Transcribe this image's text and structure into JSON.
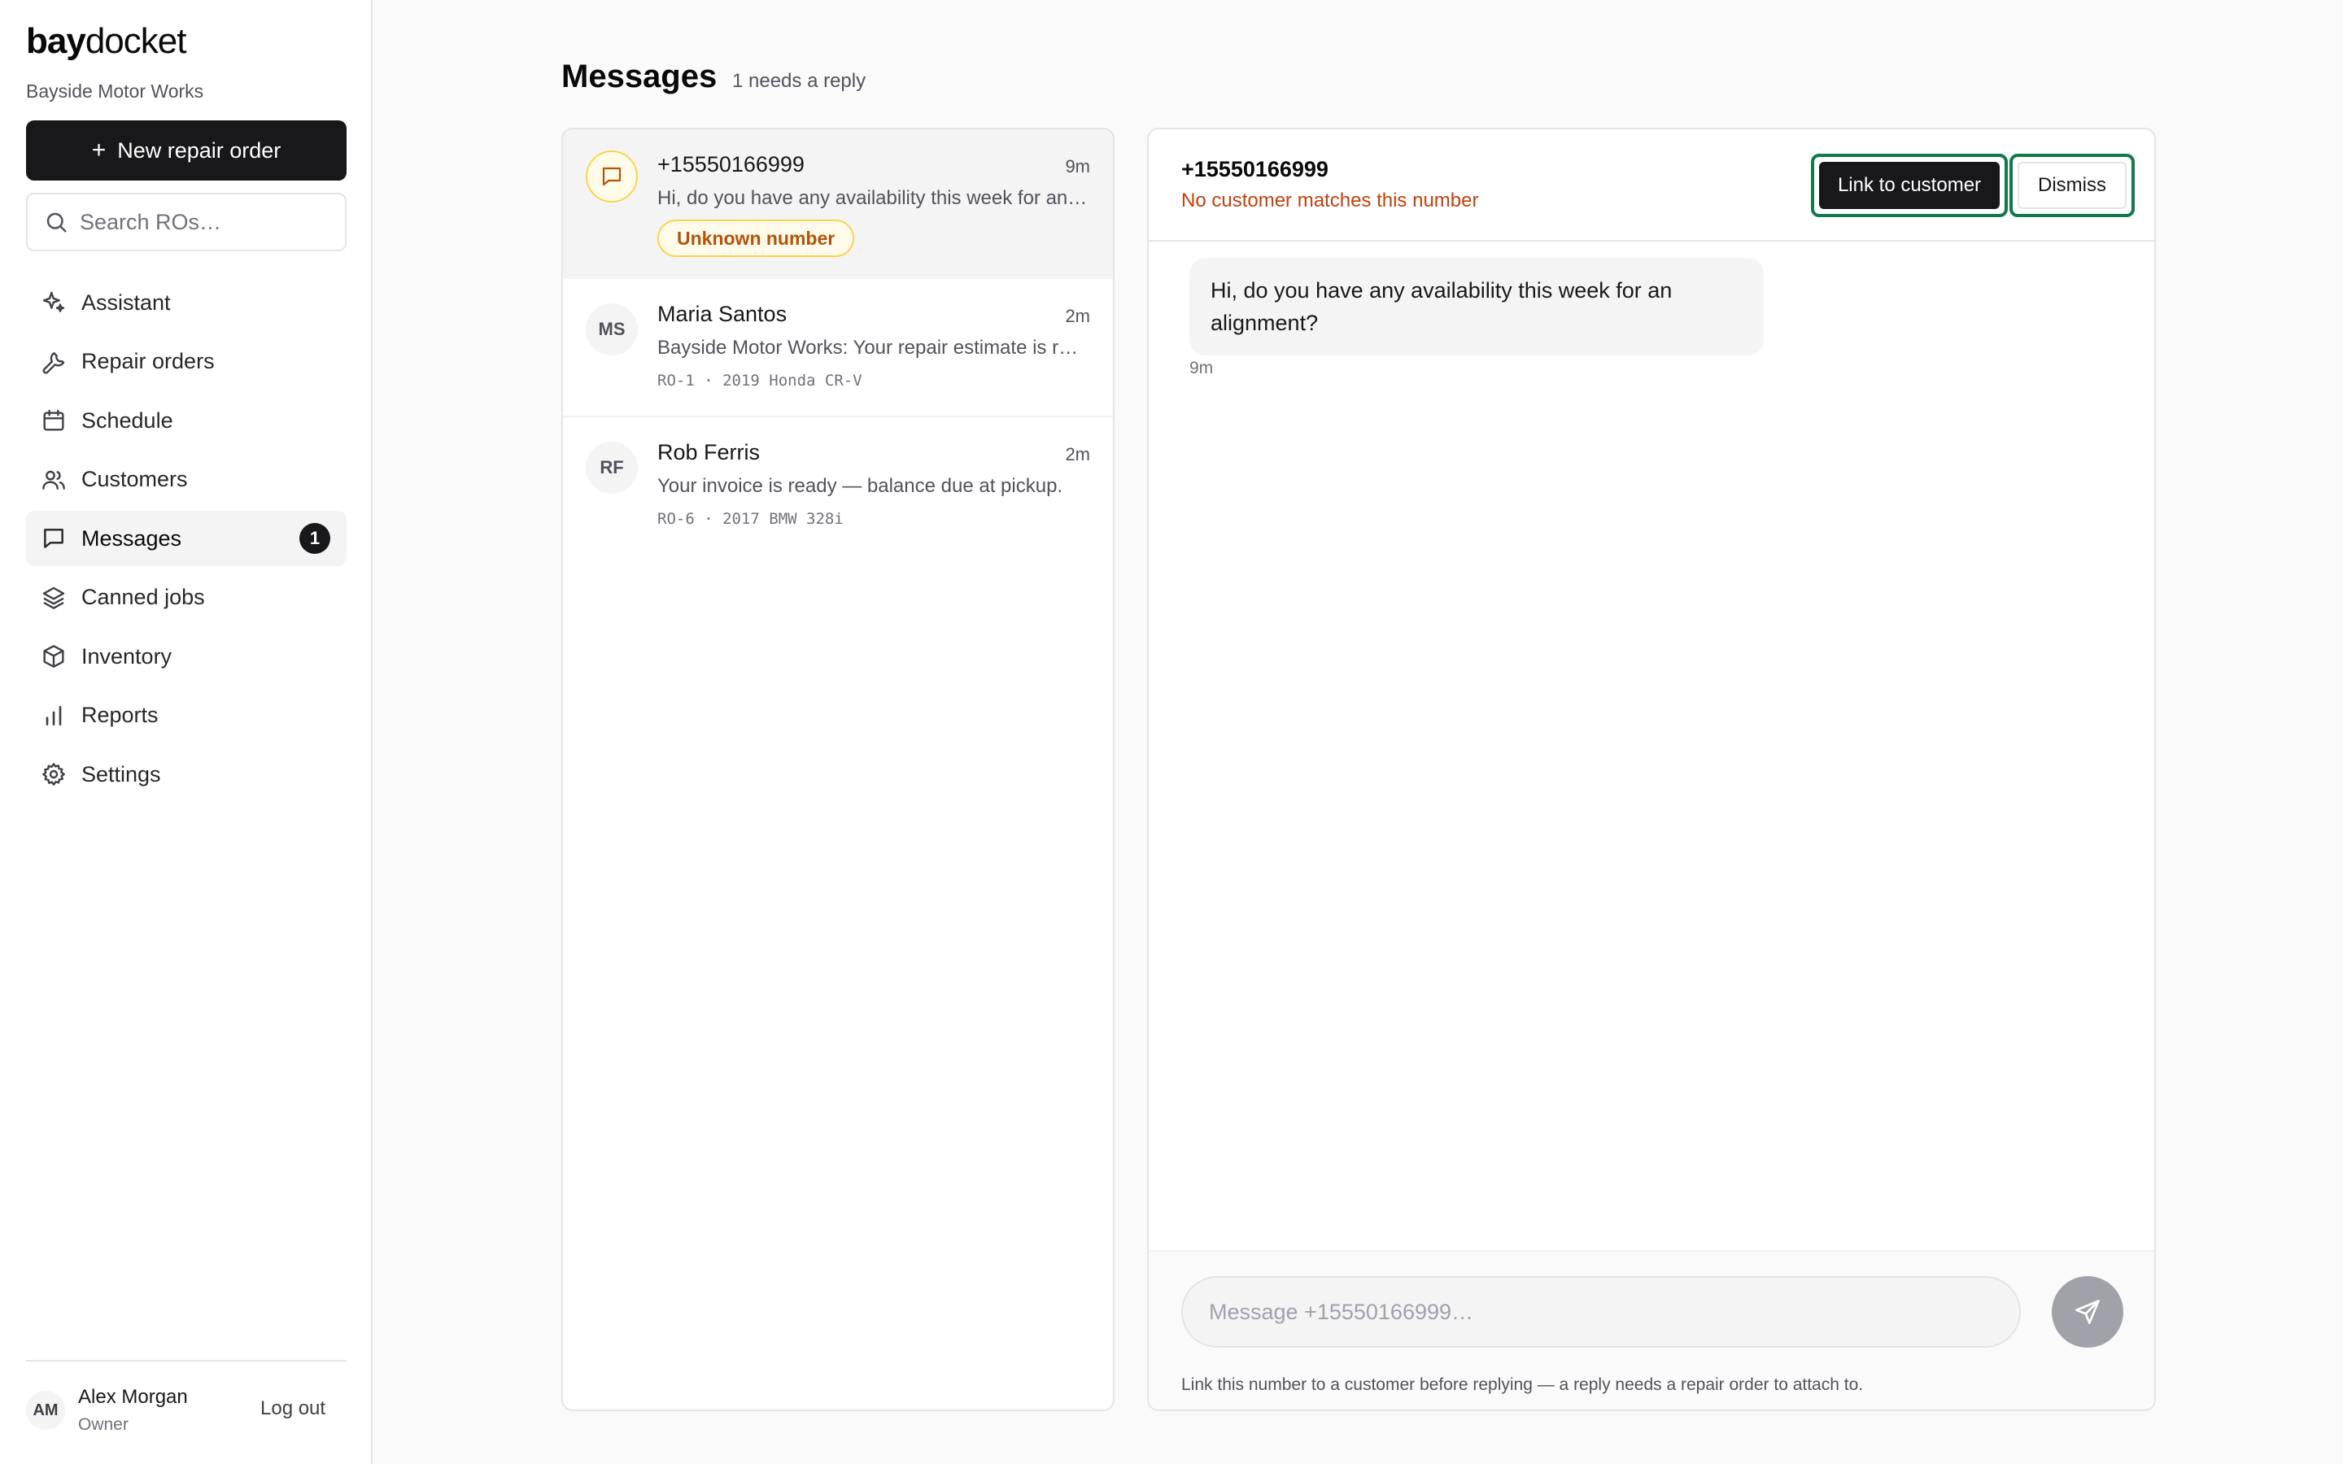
{
  "app": {
    "brand_bold": "bay",
    "brand_light": "docket",
    "shop_name": "Bayside Motor Works"
  },
  "sidebar": {
    "new_button_label": "New repair order",
    "search_placeholder": "Search ROs…",
    "nav_items": [
      {
        "label": "Assistant",
        "icon": "sparkle-icon"
      },
      {
        "label": "Repair orders",
        "icon": "wrench-icon"
      },
      {
        "label": "Schedule",
        "icon": "calendar-icon"
      },
      {
        "label": "Customers",
        "icon": "users-icon"
      },
      {
        "label": "Messages",
        "icon": "message-icon",
        "active": true,
        "badge": "1"
      },
      {
        "label": "Canned jobs",
        "icon": "layers-icon"
      },
      {
        "label": "Inventory",
        "icon": "box-icon"
      },
      {
        "label": "Reports",
        "icon": "bar-chart-icon"
      },
      {
        "label": "Settings",
        "icon": "gear-icon"
      }
    ],
    "user": {
      "initials": "AM",
      "name": "Alex Morgan",
      "role": "Owner",
      "logout_label": "Log out"
    }
  },
  "header": {
    "title": "Messages",
    "subtitle": "1 needs a reply"
  },
  "conversations": [
    {
      "name": "+15550166999",
      "time": "9m",
      "preview": "Hi, do you have any availability this week for an alignment?",
      "badge": "Unknown number",
      "selected": true
    },
    {
      "initials": "MS",
      "name": "Maria Santos",
      "time": "2m",
      "preview": "Bayside Motor Works: Your repair estimate is ready for review.",
      "meta": "RO-1 · 2019 Honda CR-V"
    },
    {
      "initials": "RF",
      "name": "Rob Ferris",
      "time": "2m",
      "preview": "Your invoice is ready — balance due at pickup.",
      "meta": "RO-6 · 2017 BMW 328i"
    }
  ],
  "thread": {
    "number": "+15550166999",
    "warning": "No customer matches this number",
    "link_button": "Link to customer",
    "dismiss_button": "Dismiss",
    "message_text": "Hi, do you have any availability this week for an alignment?",
    "message_time": "9m",
    "composer_placeholder": "Message +15550166999…",
    "composer_hint": "Link this number to a customer before replying — a reply needs a repair order to attach to."
  },
  "colors": {
    "accent": "#18181b",
    "warning": "#c2410c",
    "unknown_badge": "#b45309",
    "focus_ring": "#0f7a4a"
  }
}
